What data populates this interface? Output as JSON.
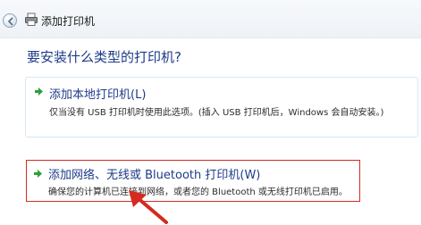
{
  "window": {
    "title": "添加打印机"
  },
  "question": "要安装什么类型的打印机?",
  "options": [
    {
      "title": "添加本地打印机(L)",
      "description": "仅当没有 USB 打印机时使用此选项。(插入 USB 打印机后，Windows 会自动安装。)"
    },
    {
      "title": "添加网络、无线或 Bluetooth 打印机(W)",
      "description": "确保您的计算机已连接到网络，或者您的 Bluetooth 或无线打印机已启用。"
    }
  ],
  "colors": {
    "heading_blue": "#1e3b8a",
    "arrow_green": "#2e9e3a",
    "highlight_red": "#d42a1f"
  },
  "icons": [
    "back-arrow-icon",
    "printer-icon",
    "green-arrow-icon",
    "red-pointer-arrow-icon"
  ]
}
